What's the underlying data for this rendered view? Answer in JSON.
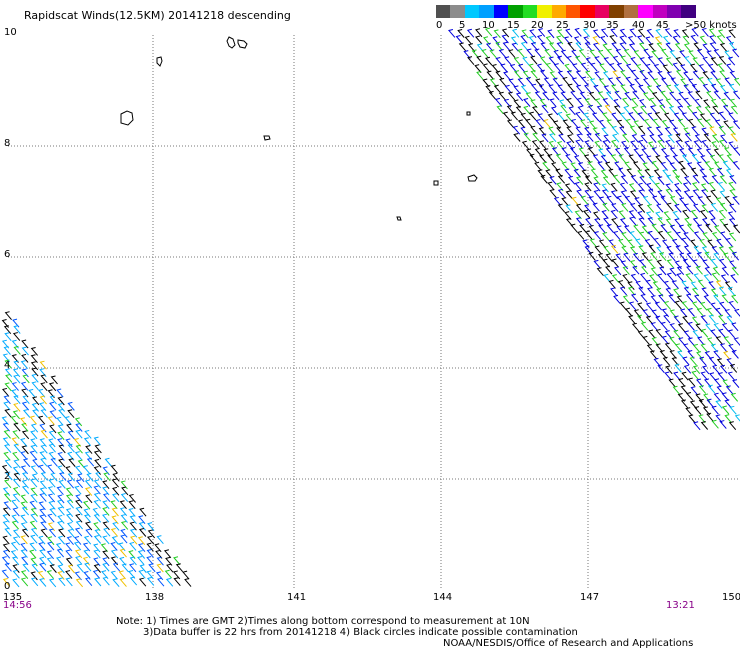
{
  "title": "Rapidscat Winds(12.5KM) 20141218 descending",
  "colorbar": {
    "colors": [
      "#505050",
      "#8c8c8c",
      "#00c8ff",
      "#00a0ff",
      "#0000ff",
      "#00a000",
      "#22dd22",
      "#f0f000",
      "#ffaa00",
      "#ff5500",
      "#ff0000",
      "#e80060",
      "#804000",
      "#b07040",
      "#ff00ff",
      "#c000c0",
      "#8000b0",
      "#400080"
    ],
    "labels": [
      "0",
      "5",
      "10",
      "15",
      "20",
      "25",
      "30",
      "35",
      "40",
      "45",
      ">50 knots"
    ]
  },
  "axes": {
    "x_ticks": [
      "135",
      "138",
      "141",
      "144",
      "147",
      "150"
    ],
    "y_ticks": [
      "0",
      "2",
      "4",
      "6",
      "8",
      "10"
    ]
  },
  "times": {
    "left": "14:56",
    "right": "13:21"
  },
  "notes": {
    "line1": "Note: 1) Times are GMT 2)Times along bottom correspond to measurement at 10N",
    "line2": "3)Data buffer is 22 hrs from 20141218 4) Black circles indicate possible contamination",
    "line3": "NOAA/NESDIS/Office of Research and Applications"
  }
}
